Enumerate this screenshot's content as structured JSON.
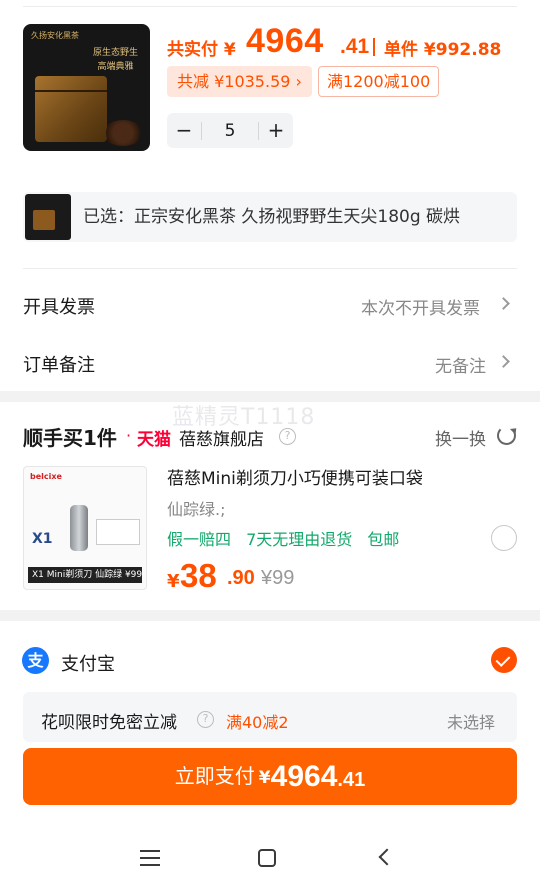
{
  "product": {
    "image_brand": "久扬安化黑茶",
    "image_slogan_1": "原生态野生",
    "image_slogan_2": "高端典雅",
    "pay_label": "共实付 ¥",
    "price_int": "4964",
    "price_dec": ".41",
    "unit_label": "单件 ¥992.88",
    "discount_tag": "共减 ¥1035.59 ›",
    "promo_tag": "满1200减100",
    "qty_minus": "−",
    "quantity": "5",
    "qty_plus": "+",
    "selected_text": "已选：正宗安化黑茶 久扬视野野生天尖180g 碳烘"
  },
  "invoice": {
    "label": "开具发票",
    "value": "本次不开具发票"
  },
  "remark": {
    "label": "订单备注",
    "value": "无备注"
  },
  "watermark": "蓝精灵T1118",
  "upsell": {
    "title": "顺手买1件",
    "dot": "·",
    "platform": "天猫",
    "store": "蓓慈旗舰店",
    "help": "?",
    "swap": "换一换",
    "image_brand": "belcixe",
    "image_model": "X1",
    "image_bar": "X1 Mini剃须刀 仙踪绿  ¥99",
    "item_title": "蓓慈Mini剃须刀小巧便携可装口袋",
    "item_variant": "仙踪绿.;",
    "tags": [
      "假一赔四",
      "7天无理由退货",
      "包邮"
    ],
    "price_symbol": "¥",
    "price_int": "38",
    "price_dec": ".90",
    "original_price": "¥99"
  },
  "payment": {
    "logo_glyph": "支",
    "method": "支付宝",
    "huabei_label": "花呗限时免密立减",
    "huabei_help": "?",
    "huabei_promo": "满40减2",
    "huabei_status": "未选择"
  },
  "pay_button": {
    "label": "立即支付",
    "symbol": "¥",
    "amount_int": "4964",
    "amount_dec": ".41"
  },
  "colors": {
    "accent": "#ff5000",
    "button": "#ff6200",
    "green": "#13a86b",
    "alipay": "#1677ff",
    "tmall": "#ff0036"
  },
  "icons": [
    "chevron-right-icon",
    "help-icon",
    "refresh-icon",
    "alipay-icon",
    "check-icon",
    "radio-icon",
    "nav-menu-icon",
    "nav-home-icon",
    "nav-back-icon"
  ]
}
